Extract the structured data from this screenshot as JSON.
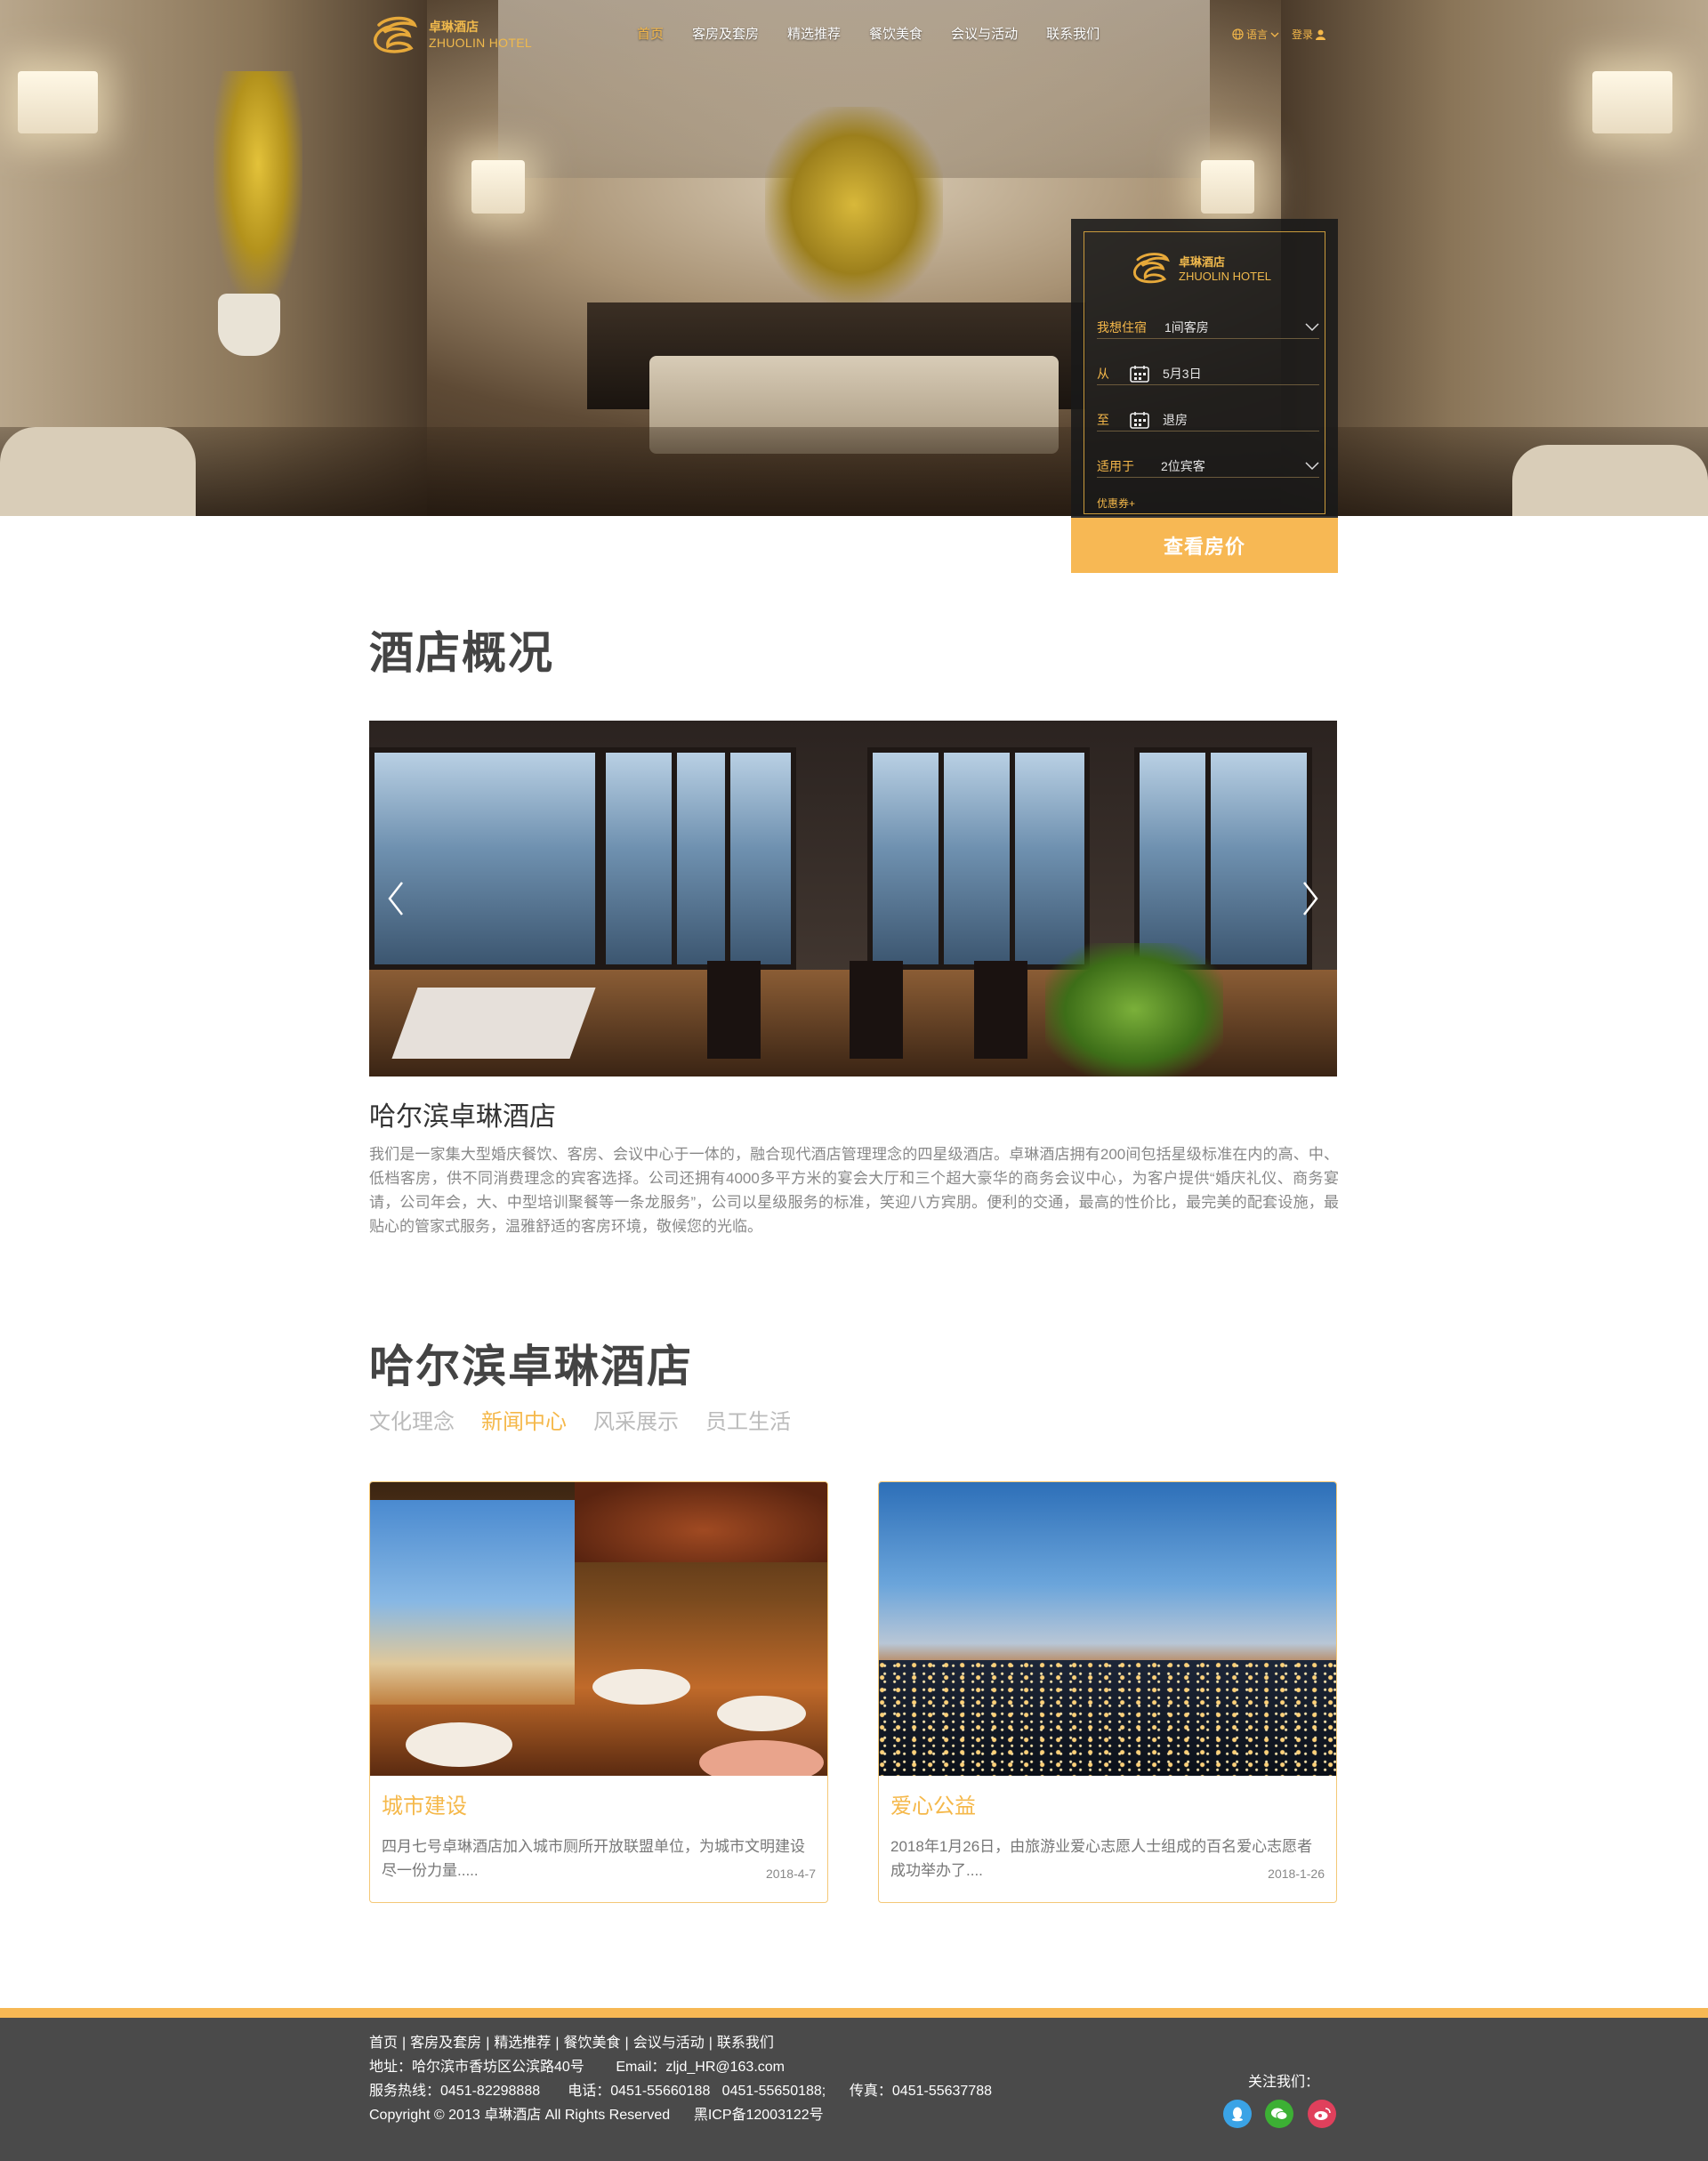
{
  "nav": {
    "logo_cn": "卓琳酒店",
    "logo_en": "ZHUOLIN HOTEL",
    "menu": [
      {
        "label": "首页",
        "active": true
      },
      {
        "label": "客房及套房",
        "active": false
      },
      {
        "label": "精选推荐",
        "active": false
      },
      {
        "label": "餐饮美食",
        "active": false
      },
      {
        "label": "会议与活动",
        "active": false
      },
      {
        "label": "联系我们",
        "active": false
      }
    ],
    "language_label": "语言",
    "login_label": "登录"
  },
  "booking": {
    "logo_cn": "卓琳酒店",
    "logo_en": "ZHUOLIN HOTEL",
    "stay_label": "我想住宿",
    "stay_value": "1间客房",
    "from_label": "从",
    "from_value": "5月3日",
    "to_label": "至",
    "to_value": "退房",
    "guests_label": "适用于",
    "guests_value": "2位宾客",
    "coupon_label": "优惠券+",
    "submit_label": "查看房价"
  },
  "overview": {
    "heading": "酒店概况",
    "hotel_name": "哈尔滨卓琳酒店",
    "description": "我们是一家集大型婚庆餐饮、客房、会议中心于一体的，融合现代酒店管理理念的四星级酒店。卓琳酒店拥有200间包括星级标准在内的高、中、低档客房，供不同消费理念的宾客选择。公司还拥有4000多平方米的宴会大厅和三个超大豪华的商务会议中心，为客户提供“婚庆礼仪、商务宴请，公司年会，大、中型培训聚餐等一条龙服务”，公司以星级服务的标准，笑迎八方宾朋。便利的交通，最高的性价比，最完美的配套设施，最贴心的管家式服务，温雅舒适的客房环境，敬候您的光临。"
  },
  "news": {
    "heading": "哈尔滨卓琳酒店",
    "tabs": [
      {
        "label": "文化理念",
        "active": false
      },
      {
        "label": "新闻中心",
        "active": true
      },
      {
        "label": "风采展示",
        "active": false
      },
      {
        "label": "员工生活",
        "active": false
      }
    ],
    "cards": [
      {
        "title": "城市建设",
        "text": "四月七号卓琳酒店加入城市厕所开放联盟单位，为城市文明建设尽一份力量.....",
        "date": "2018-4-7"
      },
      {
        "title": "爱心公益",
        "text": "2018年1月26日，由旅游业爱心志愿人士组成的百名爱心志愿者成功举办了....",
        "date": "2018-1-26"
      }
    ]
  },
  "footer": {
    "links": [
      "首页",
      "客房及套房",
      "精选推荐",
      "餐饮美食",
      "会议与活动",
      "联系我们"
    ],
    "address": "地址：哈尔滨市香坊区公滨路40号        Email：zljd_HR@163.com",
    "phones": "服务热线：0451-82298888       电话：0451-55660188   0451-55650188;      传真：0451-55637788",
    "copyright": "Copyright © 2013 卓琳酒店 All Rights Reserved      黑ICP备12003122号",
    "follow_label": "关注我们：",
    "social_icons": [
      "qq-icon",
      "wechat-icon",
      "weibo-icon"
    ],
    "accent_color": "#f7b854"
  }
}
